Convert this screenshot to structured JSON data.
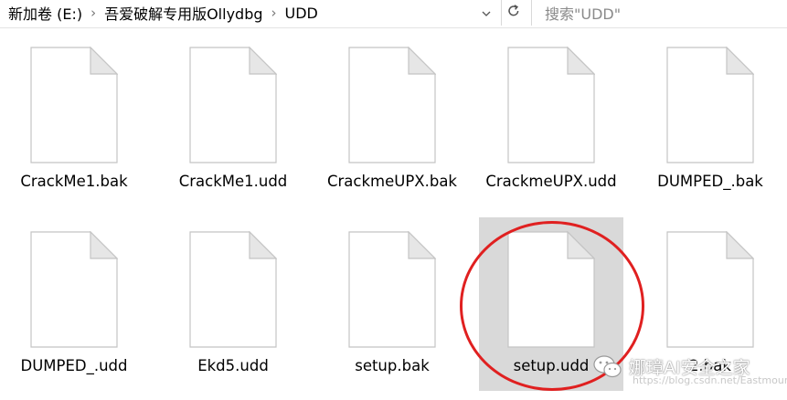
{
  "address_bar": {
    "crumbs": [
      "新加卷 (E:)",
      "吾爱破解专用版Ollydbg",
      "UDD"
    ],
    "separator": "›",
    "dropdown_icon": "chevron-down-icon",
    "refresh_icon": "refresh-icon"
  },
  "search": {
    "placeholder": "搜索\"UDD\""
  },
  "files": [
    {
      "name": "CrackMe1.bak"
    },
    {
      "name": "CrackMe1.udd"
    },
    {
      "name": "CrackmeUPX.bak"
    },
    {
      "name": "CrackmeUPX.udd"
    },
    {
      "name": "DUMPED_.bak"
    },
    {
      "name": "DUMPED_.udd"
    },
    {
      "name": "Ekd5.udd"
    },
    {
      "name": "setup.bak"
    },
    {
      "name": "setup.udd",
      "selected": true
    },
    {
      "name": "2.bak"
    }
  ],
  "watermark": {
    "text": "娜璋AI安全之家",
    "url": "https://blog.csdn.net/Eastmount"
  },
  "colors": {
    "selection": "#d9d9d9",
    "annotation": "#e02020"
  }
}
